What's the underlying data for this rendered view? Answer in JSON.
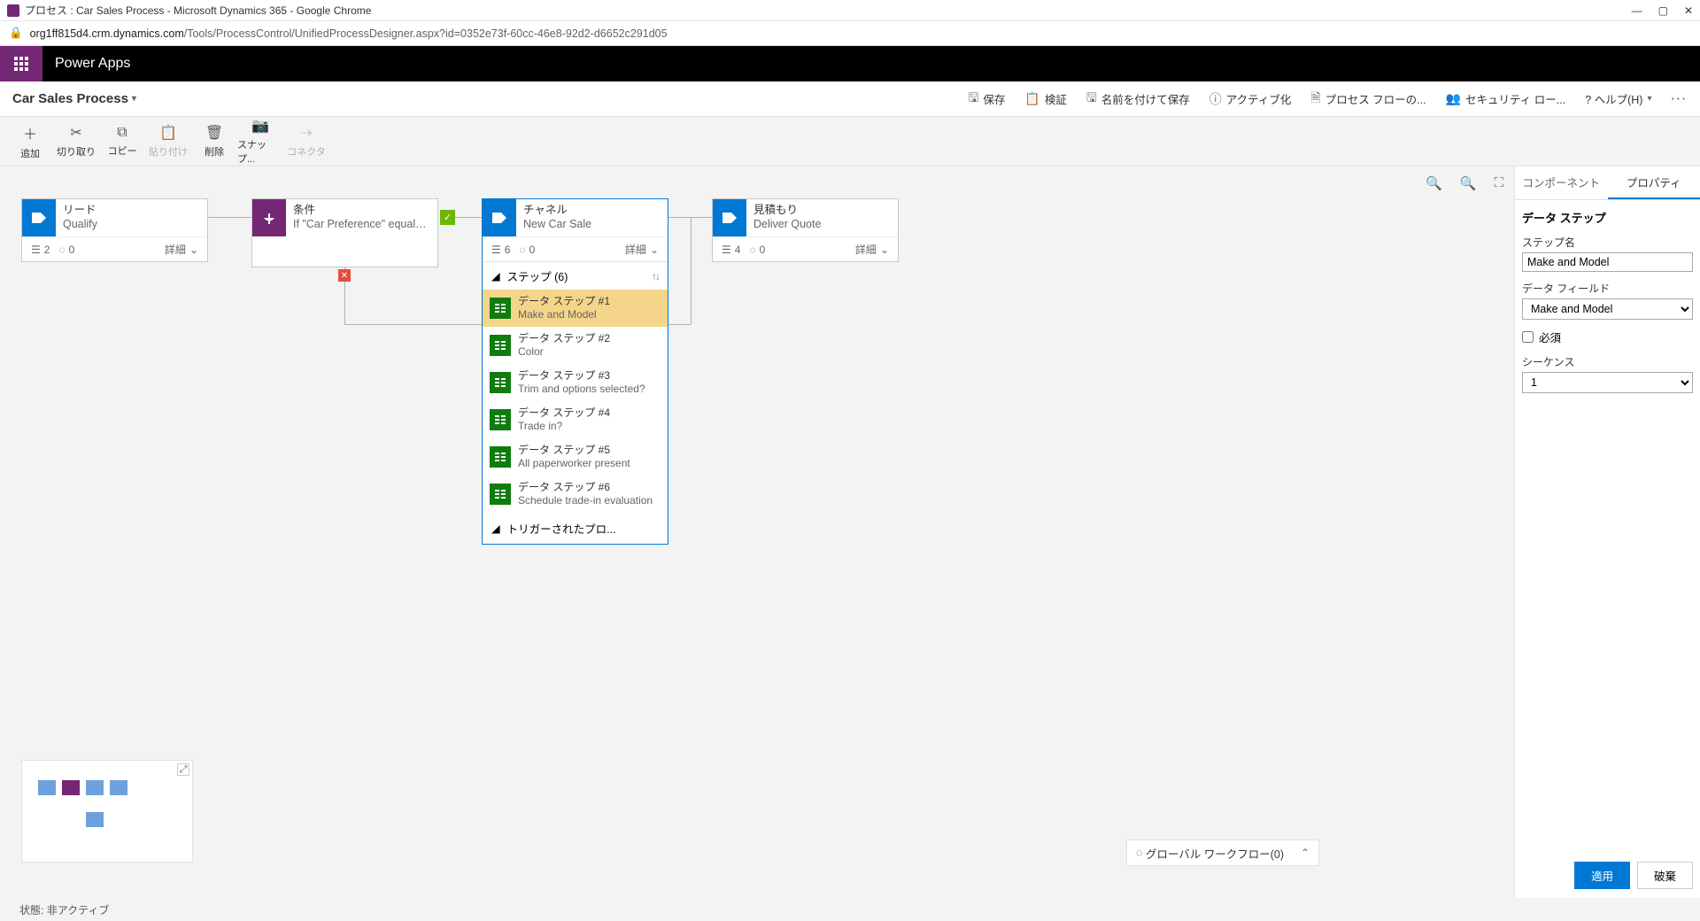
{
  "window": {
    "title": "プロセス : Car Sales Process - Microsoft Dynamics 365 - Google Chrome",
    "url_host": "org1ff815d4.crm.dynamics.com",
    "url_path": "/Tools/ProcessControl/UnifiedProcessDesigner.aspx?id=0352e73f-60cc-46e8-92d2-d6652c291d05"
  },
  "brand": "Power Apps",
  "process_title": "Car Sales Process",
  "cmd_actions": {
    "save": "保存",
    "validate": "検証",
    "saveas": "名前を付けて保存",
    "activate": "アクティブ化",
    "order": "プロセス フローの...",
    "security": "セキュリティ ロー...",
    "help": "? ヘルプ(H)"
  },
  "toolbar": {
    "add": "追加",
    "cut": "切り取り",
    "copy": "コピー",
    "paste": "貼り付け",
    "delete": "削除",
    "snapshot": "スナップ...",
    "connector": "コネクタ"
  },
  "stages": {
    "lead": {
      "type": "リード",
      "name": "Qualify",
      "steps": "2",
      "trig": "0",
      "details": "詳細"
    },
    "cond": {
      "type": "条件",
      "name": "If \"Car Preference\" equals \"New ..."
    },
    "channel": {
      "type": "チャネル",
      "name": "New Car Sale",
      "steps": "6",
      "trig": "0",
      "details": "詳細"
    },
    "quote": {
      "type": "見積もり",
      "name": "Deliver Quote",
      "steps": "4",
      "trig": "0",
      "details": "詳細"
    }
  },
  "steps_header": "ステップ (6)",
  "steps": [
    {
      "title": "データ ステップ #1",
      "sub": "Make and Model"
    },
    {
      "title": "データ ステップ #2",
      "sub": "Color"
    },
    {
      "title": "データ ステップ #3",
      "sub": "Trim and options selected?"
    },
    {
      "title": "データ ステップ #4",
      "sub": "Trade in?"
    },
    {
      "title": "データ ステップ #5",
      "sub": "All paperworker present"
    },
    {
      "title": "データ ステップ #6",
      "sub": "Schedule trade-in evaluation"
    }
  ],
  "triggered": "トリガーされたプロ...",
  "prop": {
    "tab_components": "コンポーネント",
    "tab_properties": "プロパティ",
    "heading": "データ ステップ",
    "step_name_label": "ステップ名",
    "step_name_value": "Make and Model",
    "data_field_label": "データ フィールド",
    "data_field_value": "Make and Model",
    "required_label": "必須",
    "sequence_label": "シーケンス",
    "sequence_value": "1",
    "apply": "適用",
    "discard": "破棄"
  },
  "global_workflow": "グローバル ワークフロー(0)",
  "status": {
    "label": "状態:",
    "value": "非アクティブ"
  }
}
